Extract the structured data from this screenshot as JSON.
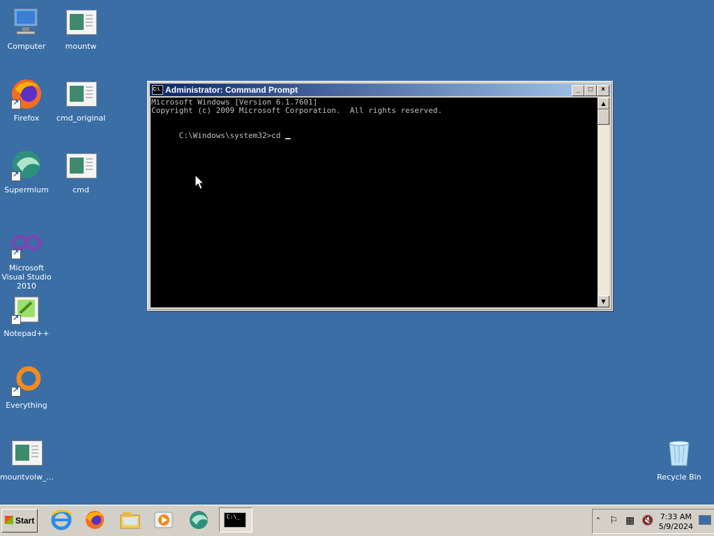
{
  "desktop": {
    "icons": [
      {
        "label": "Computer"
      },
      {
        "label": "mountw"
      },
      {
        "label": "Firefox"
      },
      {
        "label": "cmd_original"
      },
      {
        "label": "Supermium"
      },
      {
        "label": "cmd"
      },
      {
        "label": "Microsoft Visual Studio 2010"
      },
      {
        "label": "Notepad++"
      },
      {
        "label": "Everything"
      },
      {
        "label": "mountvolw_..."
      },
      {
        "label": "Recycle Bin"
      }
    ]
  },
  "window": {
    "title": "Administrator: Command Prompt",
    "icon_text": "C:\\.",
    "buttons": {
      "minimize": "_",
      "maximize": "□",
      "close": "×"
    },
    "console_lines": [
      "Microsoft Windows [Version 6.1.7601]",
      "Copyright (c) 2009 Microsoft Corporation.  All rights reserved.",
      "",
      "C:\\Windows\\system32>cd "
    ]
  },
  "taskbar": {
    "start_label": "Start",
    "active_task_text": "C:\\_",
    "clock_time": "7:33 AM",
    "clock_date": "5/9/2024"
  },
  "colors": {
    "desktop_bg": "#3a6ea5",
    "title_gradient_start": "#0a246a",
    "title_gradient_end": "#a6caf0",
    "console_bg": "#000000",
    "console_text": "#c0c0c0"
  }
}
